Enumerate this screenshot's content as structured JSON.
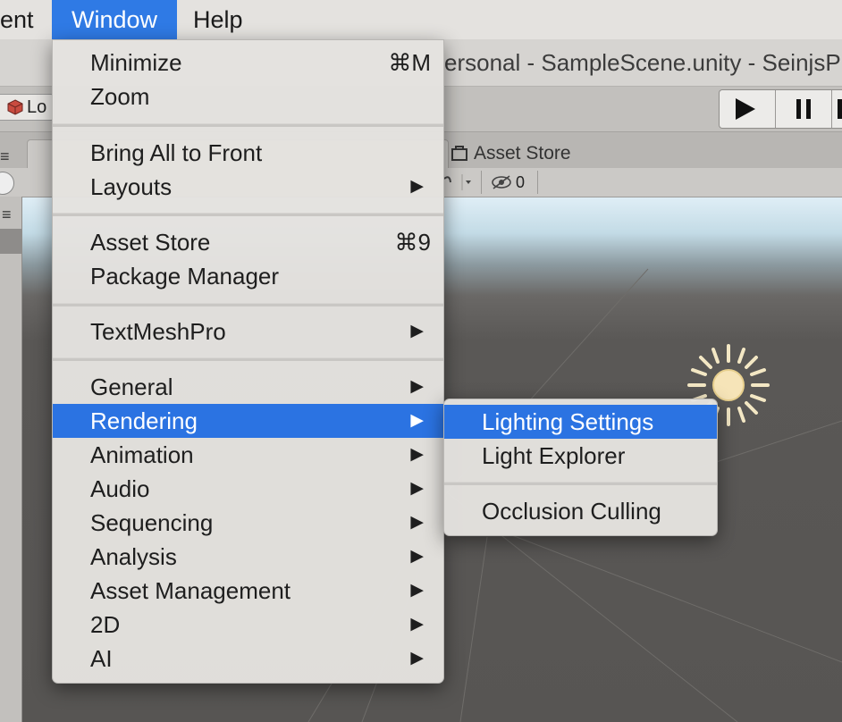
{
  "menubar": {
    "items": [
      "ent",
      "Window",
      "Help"
    ]
  },
  "window": {
    "title": "ersonal - SampleScene.unity - SeinjsP"
  },
  "toolbar": {
    "layers_label": "Lo"
  },
  "tabs": {
    "asset_store": "Asset Store",
    "hidden_objects_count": "0"
  },
  "window_menu": {
    "items": [
      {
        "label": "Minimize",
        "shortcut": "⌘M"
      },
      {
        "label": "Zoom"
      },
      {
        "label": "Bring All to Front"
      },
      {
        "label": "Layouts",
        "submenu": true
      },
      {
        "label": "Asset Store",
        "shortcut": "⌘9"
      },
      {
        "label": "Package Manager"
      },
      {
        "label": "TextMeshPro",
        "submenu": true
      },
      {
        "label": "General",
        "submenu": true
      },
      {
        "label": "Rendering",
        "submenu": true,
        "highlighted": true
      },
      {
        "label": "Animation",
        "submenu": true
      },
      {
        "label": "Audio",
        "submenu": true
      },
      {
        "label": "Sequencing",
        "submenu": true
      },
      {
        "label": "Analysis",
        "submenu": true
      },
      {
        "label": "Asset Management",
        "submenu": true
      },
      {
        "label": "2D",
        "submenu": true
      },
      {
        "label": "AI",
        "submenu": true
      }
    ]
  },
  "rendering_submenu": {
    "items": [
      {
        "label": "Lighting Settings",
        "highlighted": true
      },
      {
        "label": "Light Explorer"
      },
      {
        "label": "Occlusion Culling"
      }
    ]
  },
  "icons": {
    "submenu_arrow": "▶",
    "play": "play-icon",
    "pause": "pause-icon",
    "sun": "directional-light-icon"
  },
  "colors": {
    "highlight": "#2b73e2",
    "menubar_active": "#2f7ae5"
  }
}
